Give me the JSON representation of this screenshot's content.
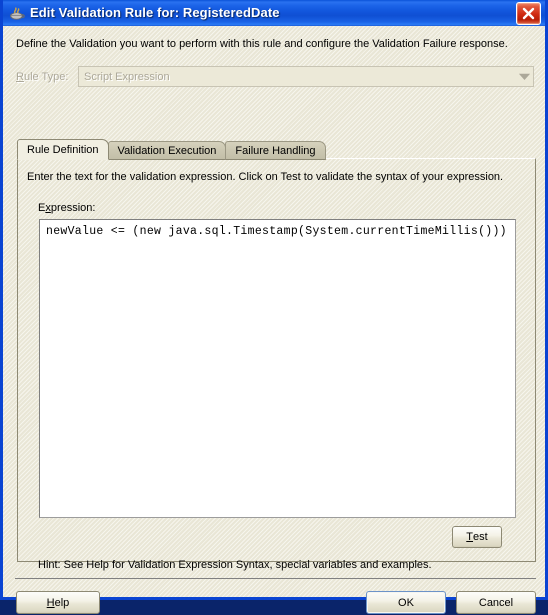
{
  "window": {
    "title": "Edit Validation Rule for: RegisteredDate",
    "icon": "java-coffee-cup-icon",
    "close_label": "Close",
    "titlebar_color": "#1257dd",
    "border_color": "#0a44d2",
    "face_color": "#ece9d8"
  },
  "dialog": {
    "intro": "Define the Validation you want to perform with this rule and configure the Validation Failure response."
  },
  "rule_type": {
    "label": "Rule Type:",
    "label_mnemonic": "R",
    "value": "Script Expression",
    "enabled": false,
    "options": [
      "Script Expression"
    ]
  },
  "tabs": [
    {
      "label": "Rule Definition",
      "active": true
    },
    {
      "label": "Validation Execution",
      "active": false
    },
    {
      "label": "Failure Handling",
      "active": false
    }
  ],
  "rule_definition": {
    "instruction": "Enter the text for the validation expression. Click on Test to validate the syntax of your expression.",
    "expression_label": "Expression:",
    "expression_label_mnemonic": "x",
    "expression_value": "newValue <= (new java.sql.Timestamp(System.currentTimeMillis()))",
    "test_button": "Test",
    "test_button_mnemonic": "T",
    "hint": "Hint: See Help for Validation Expression Syntax, special variables and examples."
  },
  "footer": {
    "help_label": "Help",
    "help_mnemonic": "H",
    "ok_label": "OK",
    "cancel_label": "Cancel",
    "default_button": "OK"
  }
}
